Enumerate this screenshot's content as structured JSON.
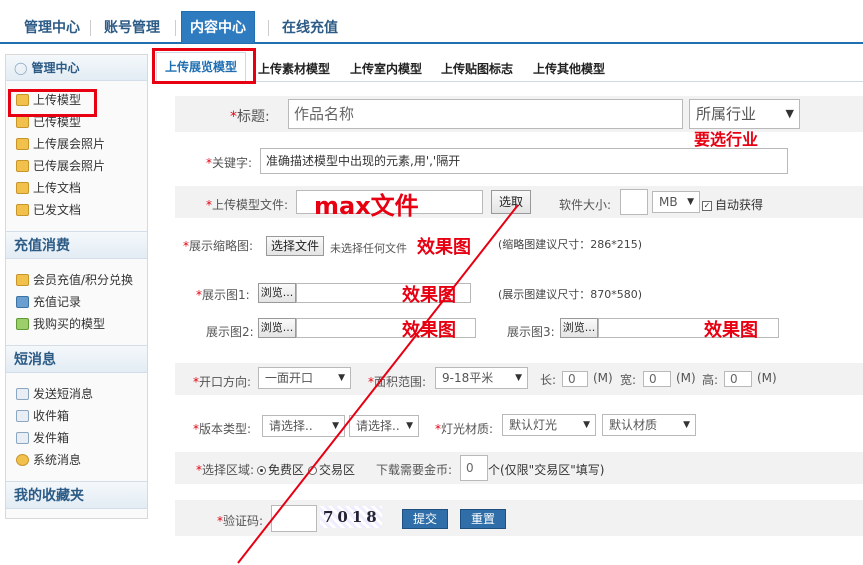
{
  "topnav": {
    "tabs": [
      "管理中心",
      "账号管理",
      "内容中心",
      "在线充值"
    ]
  },
  "sidebar": {
    "head": "管理中心",
    "group1": [
      "上传模型",
      "已传模型",
      "上传展会照片",
      "已传展会照片",
      "上传文档",
      "已发文档"
    ],
    "sec2": "充值消费",
    "group2": [
      "会员充值/积分兑换",
      "充值记录",
      "我购买的模型"
    ],
    "sec3": "短消息",
    "group3": [
      "发送短消息",
      "收件箱",
      "发件箱",
      "系统消息"
    ],
    "sec4": "我的收藏夹"
  },
  "subtabs": [
    "上传展览模型",
    "上传素材模型",
    "上传室内模型",
    "上传贴图标志",
    "上传其他模型"
  ],
  "form": {
    "title_label": "标题:",
    "title_value": "作品名称",
    "industry_select": "所属行业",
    "keywords_label": "关键字:",
    "keywords_value": "准确描述模型中出现的元素,用','隔开",
    "file_label": "上传模型文件:",
    "choose_btn": "选取",
    "size_label": "软件大小:",
    "size_unit": "MB",
    "auto_get": "自动获得",
    "thumb_label": "展示缩略图:",
    "choose_file_btn": "选择文件",
    "no_file": "未选择任何文件",
    "thumb_hint": "(缩略图建议尺寸：286*215)",
    "pic1_label": "展示图1:",
    "pic1_hint": "(展示图建议尺寸：870*580)",
    "pic2_label": "展示图2:",
    "pic3_label": "展示图3:",
    "browse": "浏览...",
    "opening_label": "开口方向:",
    "opening_value": "一面开口",
    "area_label": "面积范围:",
    "area_value": "9-18平米",
    "len_label": "长:",
    "len_value": "0",
    "width_label": "宽:",
    "width_value": "0",
    "height_label": "高:",
    "height_value": "0",
    "unit_m": "(M)",
    "version_label": "版本类型:",
    "select_placeholder": "请选择..",
    "light_label": "灯光材质:",
    "light_value": "默认灯光",
    "material_value": "默认材质",
    "region_label": "选择区域:",
    "region_free": "免费区",
    "region_trade": "交易区",
    "coins_label": "下载需要金币:",
    "coins_value": "0",
    "coins_note": "个(仅限\"交易区\"填写)",
    "captcha_label": "验证码:",
    "captcha_text": "7018",
    "submit_btn": "提交",
    "reset_btn": "重置"
  },
  "annotations": {
    "industry": "要选行业",
    "max_file": "max文件",
    "effect": "效果图"
  },
  "colors": {
    "accent": "#2f7bc0",
    "annotation_red": "#e60012"
  }
}
